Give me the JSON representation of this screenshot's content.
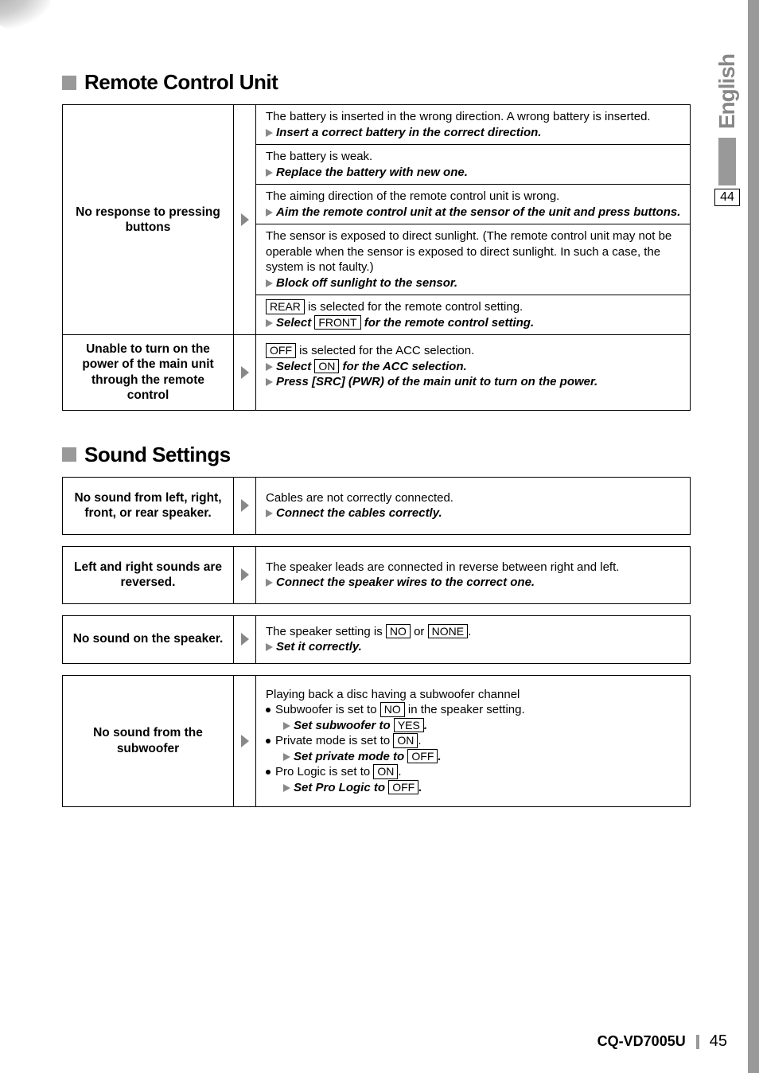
{
  "side": {
    "lang": "English",
    "page_ref": "44"
  },
  "footer": {
    "model": "CQ-VD7005U",
    "page": "45"
  },
  "sections": {
    "remote": {
      "title": "Remote Control Unit",
      "rows": [
        {
          "problem": "No response to pressing buttons",
          "sols": [
            {
              "cause": "The battery is inserted in the wrong direction. A wrong battery is inserted.",
              "fix": "Insert a correct battery in the correct direction."
            },
            {
              "cause": "The battery is weak.",
              "fix": "Replace the battery with new one."
            },
            {
              "cause": "The aiming direction of the remote control unit is wrong.",
              "fix": "Aim the remote control unit at the sensor of the unit and press buttons."
            },
            {
              "cause": "The sensor is exposed to direct sunlight. (The remote control unit may not be operable when the sensor is exposed to direct sunlight. In such a case, the system is not faulty.)",
              "fix": "Block off sunlight to the sensor."
            },
            {
              "cause_pre": "",
              "cause_box": "REAR",
              "cause_post": " is selected for the remote control setting.",
              "fix_pre": "Select ",
              "fix_box": "FRONT",
              "fix_post": " for the remote control setting."
            }
          ]
        },
        {
          "problem": "Unable to turn on the power of the main unit through the remote control",
          "sols": [
            {
              "cause_pre": "",
              "cause_box": "OFF",
              "cause_post": " is selected for the ACC selection.",
              "fix_pre": "Select ",
              "fix_box": "ON",
              "fix_post": " for the ACC selection.",
              "fix2": "Press [SRC] (PWR) of the main unit to turn on the power."
            }
          ]
        }
      ]
    },
    "sound": {
      "title": "Sound Settings",
      "rows": [
        {
          "problem": "No sound from left, right, front, or rear speaker.",
          "sols": [
            {
              "cause": "Cables are not correctly connected.",
              "fix": "Connect the cables correctly."
            }
          ]
        },
        {
          "problem": "Left and right sounds are reversed.",
          "sols": [
            {
              "cause": "The speaker leads are connected in reverse between right and left.",
              "fix": "Connect the speaker wires to the correct one."
            }
          ]
        },
        {
          "problem": "No sound on the speaker.",
          "sols": [
            {
              "cause_pre": "The speaker setting is ",
              "cause_box": "NO",
              "cause_mid": " or ",
              "cause_box2": "NONE",
              "cause_post": ".",
              "fix": "Set it correctly."
            }
          ]
        },
        {
          "problem": "No sound from the subwoofer",
          "sw": {
            "intro": "Playing back a disc having a subwoofer channel",
            "b1_pre": "Subwoofer is set to ",
            "b1_box": "NO",
            "b1_post": " in the speaker setting.",
            "b1_fix_pre": "Set subwoofer to ",
            "b1_fix_box": "YES",
            "b1_fix_post": ".",
            "b2_pre": "Private mode is set to ",
            "b2_box": "ON",
            "b2_post": ".",
            "b2_fix_pre": "Set private mode to ",
            "b2_fix_box": "OFF",
            "b2_fix_post": ".",
            "b3_pre": "Pro Logic is set to ",
            "b3_box": "ON",
            "b3_post": ".",
            "b3_fix_pre": "Set Pro Logic to ",
            "b3_fix_box": "OFF",
            "b3_fix_post": "."
          }
        }
      ]
    }
  }
}
